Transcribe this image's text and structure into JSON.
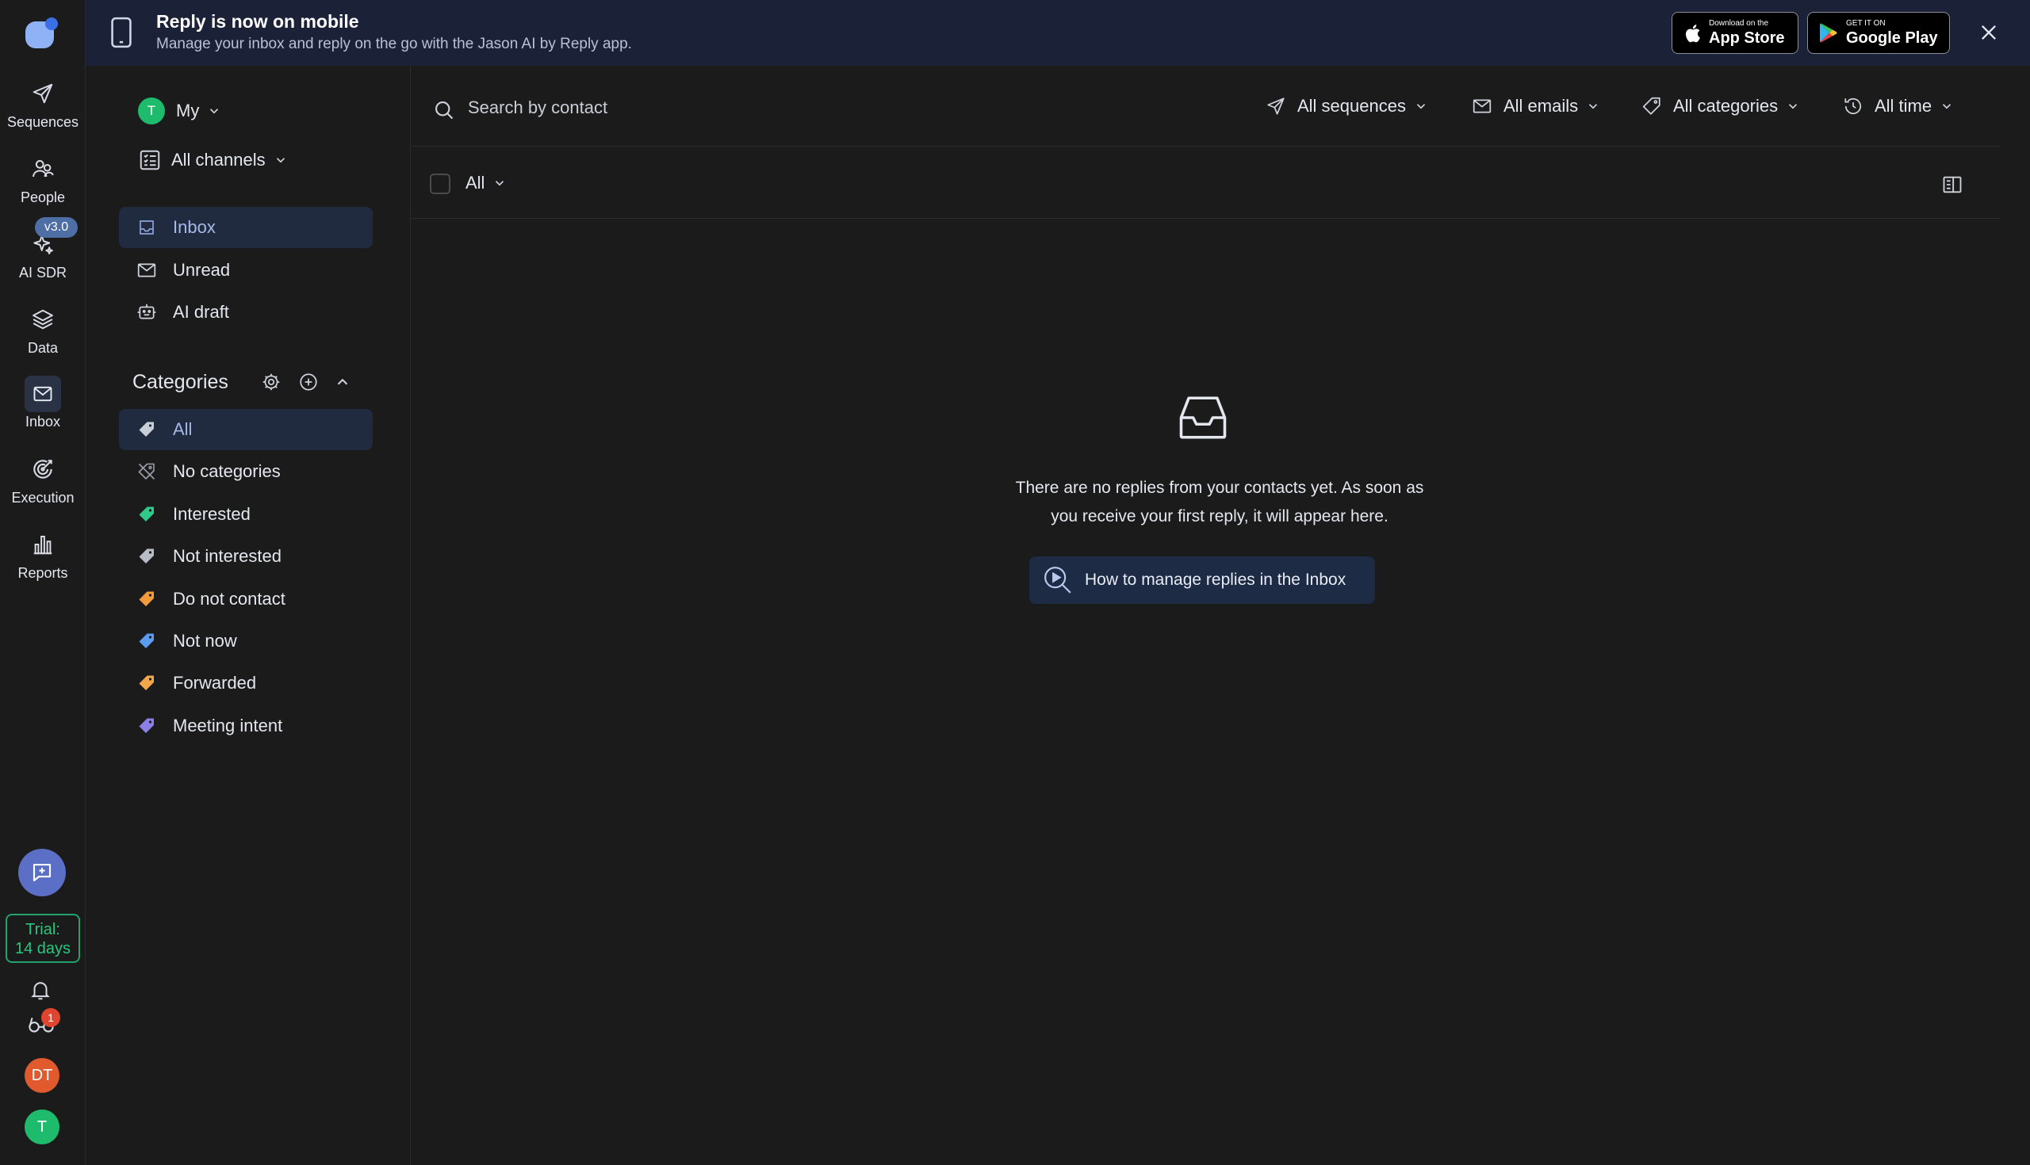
{
  "rail": {
    "items": [
      {
        "label": "Sequences",
        "icon": "send-icon"
      },
      {
        "label": "People",
        "icon": "people-icon"
      },
      {
        "label": "AI SDR",
        "icon": "sparkle-icon"
      },
      {
        "label": "Data",
        "icon": "layers-icon"
      },
      {
        "label": "Inbox",
        "icon": "mail-icon"
      },
      {
        "label": "Execution",
        "icon": "target-icon"
      },
      {
        "label": "Reports",
        "icon": "bar-chart-icon"
      }
    ],
    "ai_sdr_badge": "v3.0",
    "trial_line1": "Trial:",
    "trial_line2": "14 days",
    "notifications_badge": "1",
    "user_avatar_initials": "DT",
    "workspace_avatar_initial": "T"
  },
  "banner": {
    "title": "Reply is now on mobile",
    "subtitle": "Manage your inbox and reply on the go with the Jason AI by Reply app.",
    "app_store_small": "Download on the",
    "app_store_big": "App Store",
    "google_play_small": "GET IT ON",
    "google_play_big": "Google Play"
  },
  "sidebar": {
    "owner_initial": "T",
    "owner_label": "My",
    "channels_label": "All channels",
    "nav": [
      {
        "label": "Inbox",
        "icon": "inbox-icon"
      },
      {
        "label": "Unread",
        "icon": "envelope-icon"
      },
      {
        "label": "AI draft",
        "icon": "robot-icon"
      }
    ],
    "categories_title": "Categories",
    "categories": [
      {
        "label": "All",
        "color": "#c9cdd6"
      },
      {
        "label": "No categories",
        "color": "#9aa0aa"
      },
      {
        "label": "Interested",
        "color": "#2fc98a"
      },
      {
        "label": "Not interested",
        "color": "#b7bcc6"
      },
      {
        "label": "Do not contact",
        "color": "#f39a3c"
      },
      {
        "label": "Not now",
        "color": "#5b9cf0"
      },
      {
        "label": "Forwarded",
        "color": "#f3a64a"
      },
      {
        "label": "Meeting intent",
        "color": "#8b7fe8"
      }
    ]
  },
  "main": {
    "search_placeholder": "Search by contact",
    "filters": {
      "sequences": "All sequences",
      "emails": "All emails",
      "categories": "All categories",
      "time": "All time"
    },
    "list_filter": "All",
    "empty_line1": "There are no replies from your contacts yet. As soon as",
    "empty_line2": "you receive your first reply, it will appear here.",
    "howto_label": "How to manage replies in the Inbox"
  },
  "colors": {
    "accent": "#5b6fc6",
    "banner_bg": "#1b2238",
    "active_nav_bg": "#212b40",
    "trial_green": "#28c77f"
  }
}
